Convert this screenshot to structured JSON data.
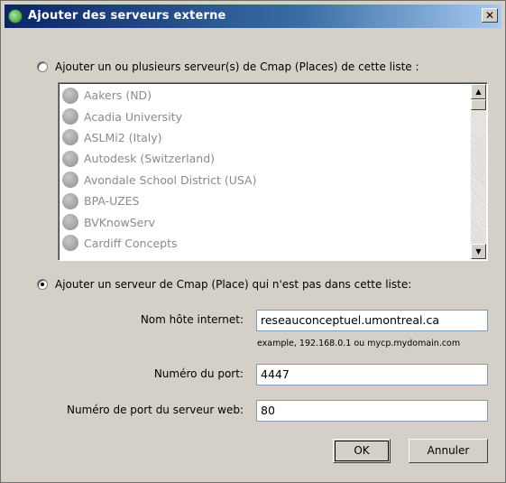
{
  "window": {
    "title": "Ajouter des serveurs externe"
  },
  "options": {
    "from_list_label": "Ajouter un ou plusieurs serveur(s) de Cmap (Places) de cette liste :",
    "not_in_list_label": "Ajouter un serveur de Cmap (Place) qui n'est pas dans cette liste:",
    "selected": "not_in_list"
  },
  "server_list": [
    "Aakers (ND)",
    "Acadia University",
    "ASLMi2 (Italy)",
    "Autodesk (Switzerland)",
    "Avondale School District (USA)",
    "BPA-UZES",
    "BVKnowServ",
    "Cardiff Concepts"
  ],
  "form": {
    "host_label": "Nom hôte internet:",
    "host_value": "reseauconceptuel.umontreal.ca",
    "host_hint": "example, 192.168.0.1 ou mycp.mydomain.com",
    "port_label": "Numéro du port:",
    "port_value": "4447",
    "web_port_label": "Numéro de port du serveur web:",
    "web_port_value": "80"
  },
  "buttons": {
    "ok": "OK",
    "cancel": "Annuler"
  }
}
